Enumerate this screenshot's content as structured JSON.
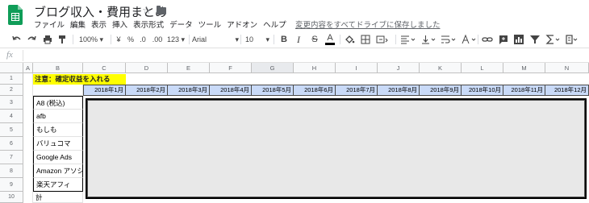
{
  "header": {
    "doc_title": "ブログ収入・費用まとめ",
    "menu": [
      "ファイル",
      "編集",
      "表示",
      "挿入",
      "表示形式",
      "データ",
      "ツール",
      "アドオン",
      "ヘルプ"
    ],
    "save_status": "変更内容をすべてドライブに保存しました"
  },
  "toolbar": {
    "zoom": "100%",
    "currency": "¥",
    "percent": "%",
    "decimal_decrease": ".0",
    "decimal_increase": ".00",
    "more_formats": "123",
    "font": "Arial",
    "font_size": "10",
    "bold": "B",
    "italic": "I",
    "strikethrough": "S",
    "text_color": "A"
  },
  "formula_bar": {
    "label": "fx"
  },
  "grid": {
    "columns": [
      "A",
      "B",
      "C",
      "D",
      "E",
      "F",
      "G",
      "H",
      "I",
      "J",
      "K",
      "L",
      "M",
      "N"
    ],
    "rows": [
      "1",
      "2",
      "3",
      "4",
      "5",
      "6",
      "7",
      "8",
      "9",
      "10"
    ],
    "note": "注意：確定収益を入れる",
    "months": [
      "2018年1月",
      "2018年2月",
      "2018年3月",
      "2018年4月",
      "2018年5月",
      "2018年6月",
      "2018年7月",
      "2018年8月",
      "2018年9月",
      "2018年10月",
      "2018年11月",
      "2018年12月"
    ],
    "row_labels": [
      "A8 (税込)",
      "afb",
      "もしも",
      "バリュコマ",
      "Google Ads",
      "Amazon アソシ",
      "楽天アフィ",
      "計"
    ]
  }
}
